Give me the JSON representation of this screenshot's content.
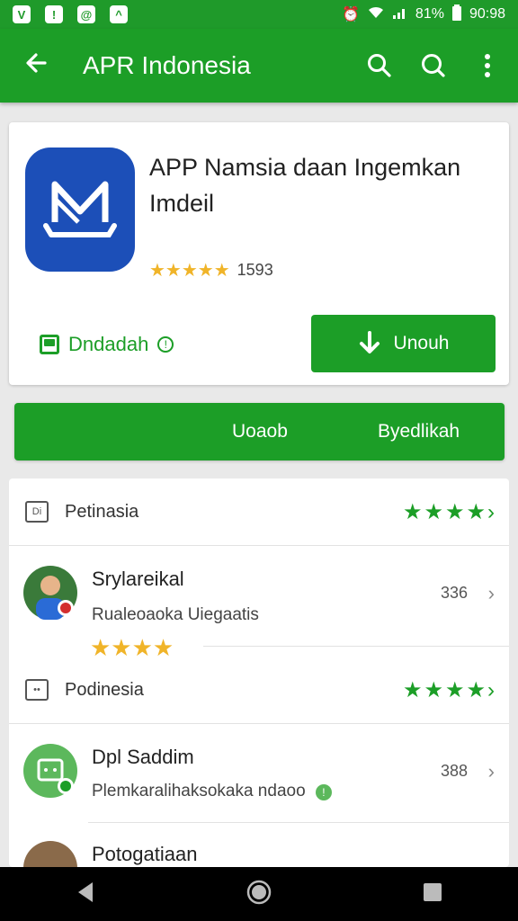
{
  "status": {
    "time": "90:98",
    "battery": "81%"
  },
  "header": {
    "title": "APR Indonesia"
  },
  "app": {
    "name": "APP Namsia daan Ingemkan Imdeil",
    "rating_stars": 5,
    "rating_value": "1593",
    "download_label": "Dndadah",
    "install_label": "Unouh"
  },
  "tabs": {
    "left": "Uoaob",
    "right": "Byedlikah"
  },
  "sections": [
    {
      "title": "Petinasia",
      "stars": 4
    },
    {
      "title": "Podinesia",
      "stars": 4
    }
  ],
  "items": [
    {
      "title": "Srylareikal",
      "subtitle": "Rualeoaoka Uiegaatis",
      "count": "336",
      "stars": 4
    },
    {
      "title": "Dpl Saddim",
      "subtitle": "Plemkaralihaksokaka ndaoo",
      "count": "388"
    },
    {
      "title": "Potogatiaan"
    }
  ],
  "colors": {
    "primary": "#1c9e27",
    "accent_star": "#f0b429",
    "app_icon": "#1c4fb8"
  }
}
